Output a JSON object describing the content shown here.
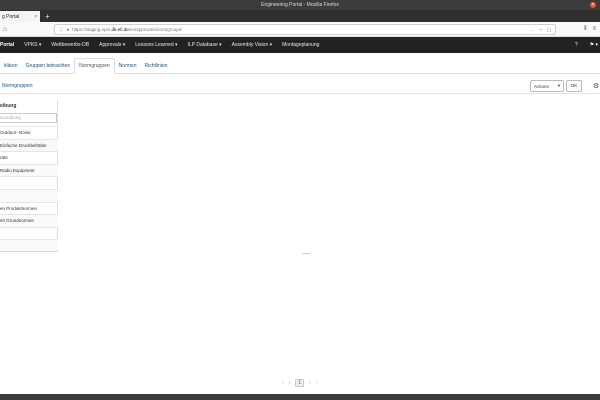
{
  "window": {
    "title": "Engineering Portal - Mozilla Firefox",
    "close": "×"
  },
  "tab": {
    "label": "g Portal",
    "close": "×",
    "new": "+"
  },
  "nav": {
    "home_icon": "⌂",
    "url_prefix": "https://staging.epm.",
    "url_domain": "dk-efi.de",
    "url_path": "/en/approvals/normgroups/",
    "tools": [
      "…",
      "☆",
      "▢"
    ],
    "right_icons": [
      "⫴",
      "≡"
    ]
  },
  "appbar": {
    "brand": "Portal",
    "items": [
      "VPKS ▾",
      "Wettbewerbs-DB",
      "Approvals ▾",
      "Lessons Learned ▾",
      "ILP Database ▾",
      "Assembly Vision ▾",
      "Montageplanung"
    ],
    "help": "?",
    "flag": "⚑ ▾"
  },
  "subtabs": [
    "klären",
    "Gruppen betrachten",
    "Normgruppen",
    "Normen",
    "Richtlinien"
  ],
  "breadcrumb": "Normgruppen",
  "actions": {
    "label": "Actions",
    "caret": "▾",
    "ok": "OK",
    "cog": "⚙"
  },
  "table": {
    "header": "eibung",
    "filter_placeholder": "ichreibung",
    "rows": [
      "Outdoor- Noise",
      "Einfache Druckbehälter",
      "räte",
      "Radio Equipment",
      "",
      "",
      "en Produktnormen",
      "en Grundnormen",
      "",
      ""
    ]
  },
  "pagination": {
    "prev": "‹",
    "current": "1",
    "next": "›",
    "first": "‹",
    "last": "›"
  }
}
